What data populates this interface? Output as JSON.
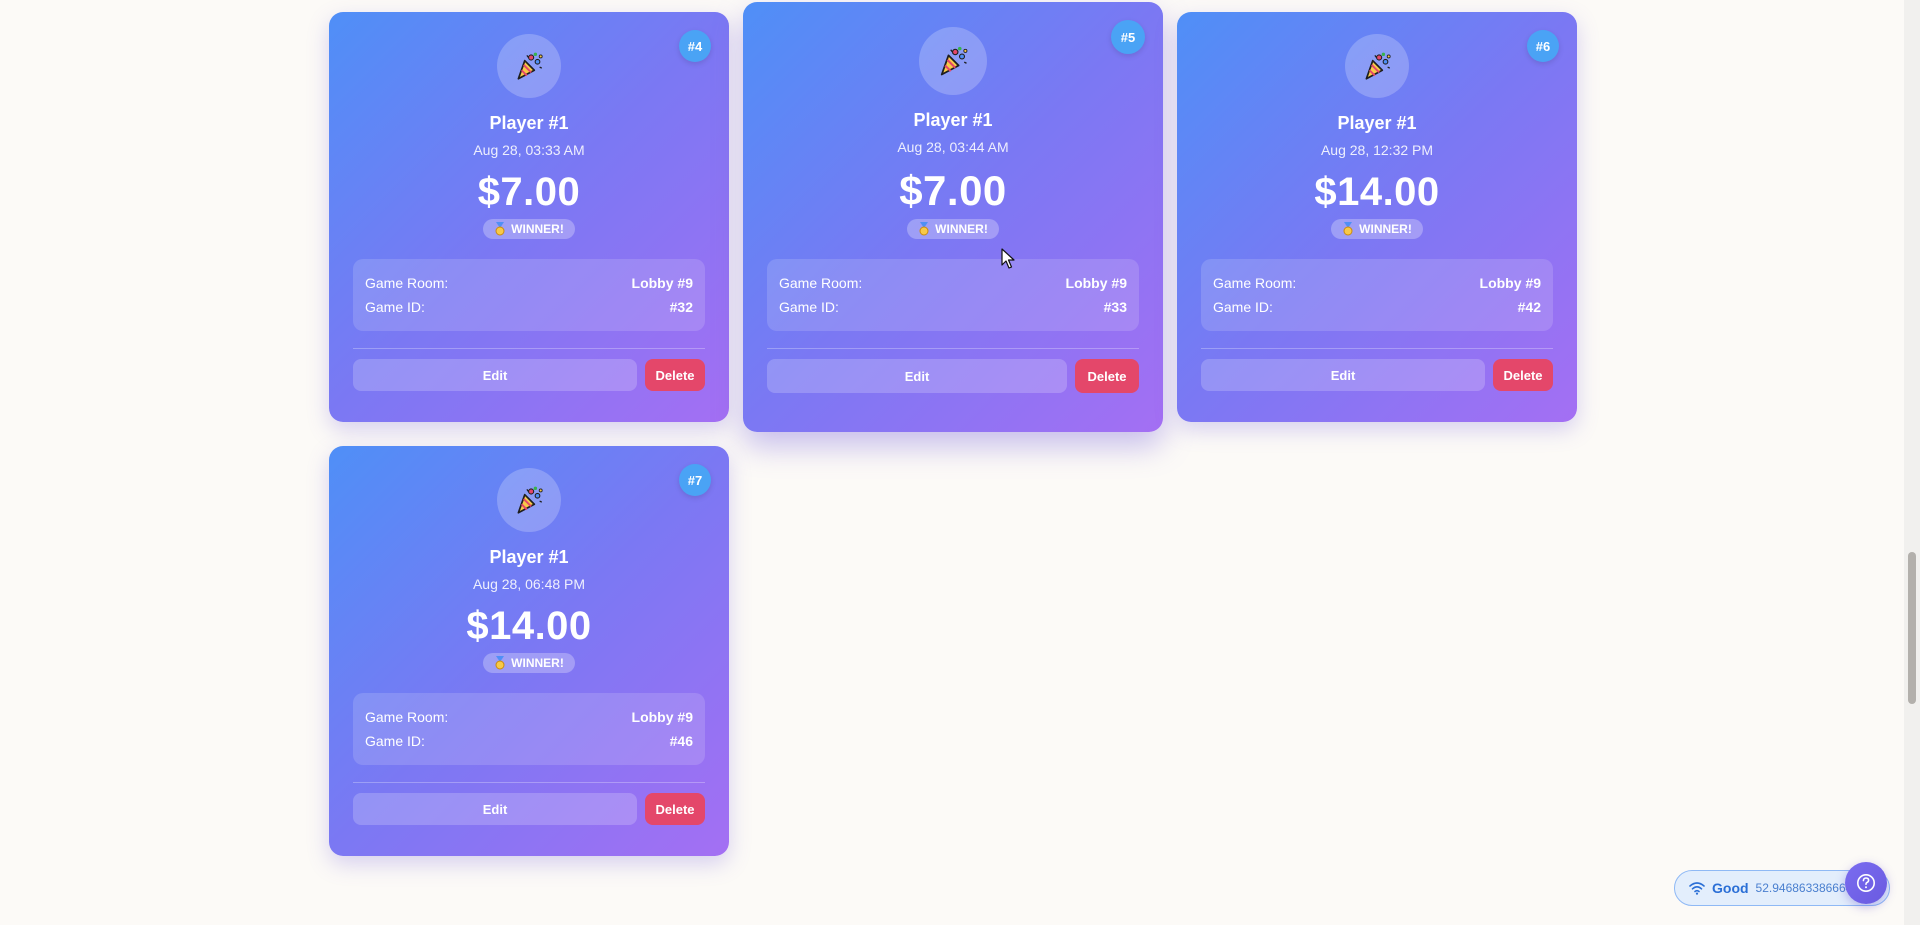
{
  "cards": [
    {
      "badge": "#4",
      "player": "Player #1",
      "date": "Aug 28, 03:33 AM",
      "amount": "$7.00",
      "winner": "WINNER!",
      "room_label": "Game Room:",
      "room_value": "Lobby #9",
      "id_label": "Game ID:",
      "id_value": "#32",
      "edit": "Edit",
      "delete": "Delete"
    },
    {
      "badge": "#5",
      "player": "Player #1",
      "date": "Aug 28, 03:44 AM",
      "amount": "$7.00",
      "winner": "WINNER!",
      "room_label": "Game Room:",
      "room_value": "Lobby #9",
      "id_label": "Game ID:",
      "id_value": "#33",
      "edit": "Edit",
      "delete": "Delete"
    },
    {
      "badge": "#6",
      "player": "Player #1",
      "date": "Aug 28, 12:32 PM",
      "amount": "$14.00",
      "winner": "WINNER!",
      "room_label": "Game Room:",
      "room_value": "Lobby #9",
      "id_label": "Game ID:",
      "id_value": "#42",
      "edit": "Edit",
      "delete": "Delete"
    },
    {
      "badge": "#7",
      "player": "Player #1",
      "date": "Aug 28, 06:48 PM",
      "amount": "$14.00",
      "winner": "WINNER!",
      "room_label": "Game Room:",
      "room_value": "Lobby #9",
      "id_label": "Game ID:",
      "id_value": "#46",
      "edit": "Edit",
      "delete": "Delete"
    }
  ],
  "icons": {
    "avatar": "party-popper-icon",
    "winner": "medal-icon",
    "connection": "wifi-icon",
    "help": "help-icon"
  },
  "connection": {
    "status": "Good",
    "value": "52.946863386664"
  },
  "colors": {
    "card_gradient_start": "#4f8ff7",
    "card_gradient_end": "#a46ff3",
    "badge": "#4aa3f5",
    "delete_button": "#e4476a",
    "connection_text": "#2b6fd6",
    "help_button": "#7a6cf0"
  }
}
